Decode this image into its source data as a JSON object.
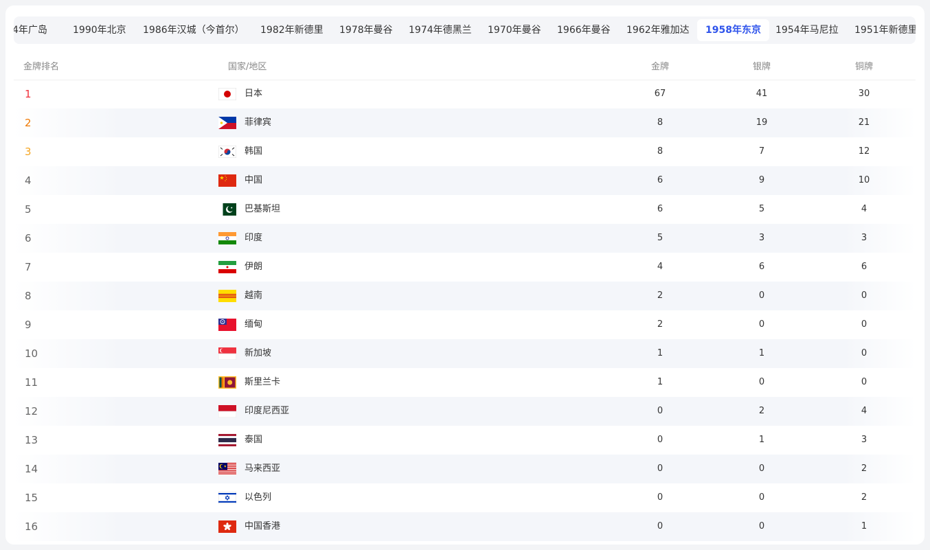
{
  "tabs": [
    {
      "label": "4年广岛",
      "active": false
    },
    {
      "label": "1990年北京",
      "active": false
    },
    {
      "label": "1986年汉城（今首尔）",
      "active": false
    },
    {
      "label": "1982年新德里",
      "active": false
    },
    {
      "label": "1978年曼谷",
      "active": false
    },
    {
      "label": "1974年德黑兰",
      "active": false
    },
    {
      "label": "1970年曼谷",
      "active": false
    },
    {
      "label": "1966年曼谷",
      "active": false
    },
    {
      "label": "1962年雅加达",
      "active": false
    },
    {
      "label": "1958年东京",
      "active": true
    },
    {
      "label": "1954年马尼拉",
      "active": false
    },
    {
      "label": "1951年新德里",
      "active": false
    }
  ],
  "table": {
    "headers": {
      "rank": "金牌排名",
      "country": "国家/地区",
      "gold": "金牌",
      "silver": "银牌",
      "bronze": "铜牌"
    },
    "rows": [
      {
        "rank": "1",
        "country": "日本",
        "flag": "japan",
        "gold": "67",
        "silver": "41",
        "bronze": "30"
      },
      {
        "rank": "2",
        "country": "菲律宾",
        "flag": "philippines",
        "gold": "8",
        "silver": "19",
        "bronze": "21"
      },
      {
        "rank": "3",
        "country": "韩国",
        "flag": "korea",
        "gold": "8",
        "silver": "7",
        "bronze": "12"
      },
      {
        "rank": "4",
        "country": "中国",
        "flag": "china",
        "gold": "6",
        "silver": "9",
        "bronze": "10"
      },
      {
        "rank": "5",
        "country": "巴基斯坦",
        "flag": "pakistan",
        "gold": "6",
        "silver": "5",
        "bronze": "4"
      },
      {
        "rank": "6",
        "country": "印度",
        "flag": "india",
        "gold": "5",
        "silver": "3",
        "bronze": "3"
      },
      {
        "rank": "7",
        "country": "伊朗",
        "flag": "iran",
        "gold": "4",
        "silver": "6",
        "bronze": "6"
      },
      {
        "rank": "8",
        "country": "越南",
        "flag": "south-vietnam",
        "gold": "2",
        "silver": "0",
        "bronze": "0"
      },
      {
        "rank": "9",
        "country": "缅甸",
        "flag": "myanmar",
        "gold": "2",
        "silver": "0",
        "bronze": "0"
      },
      {
        "rank": "10",
        "country": "新加坡",
        "flag": "singapore",
        "gold": "1",
        "silver": "1",
        "bronze": "0"
      },
      {
        "rank": "11",
        "country": "斯里兰卡",
        "flag": "sri-lanka",
        "gold": "1",
        "silver": "0",
        "bronze": "0"
      },
      {
        "rank": "12",
        "country": "印度尼西亚",
        "flag": "indonesia",
        "gold": "0",
        "silver": "2",
        "bronze": "4"
      },
      {
        "rank": "13",
        "country": "泰国",
        "flag": "thailand",
        "gold": "0",
        "silver": "1",
        "bronze": "3"
      },
      {
        "rank": "14",
        "country": "马来西亚",
        "flag": "malaysia",
        "gold": "0",
        "silver": "0",
        "bronze": "2"
      },
      {
        "rank": "15",
        "country": "以色列",
        "flag": "israel",
        "gold": "0",
        "silver": "0",
        "bronze": "2"
      },
      {
        "rank": "16",
        "country": "中国香港",
        "flag": "hong-kong",
        "gold": "0",
        "silver": "0",
        "bronze": "1"
      }
    ]
  }
}
